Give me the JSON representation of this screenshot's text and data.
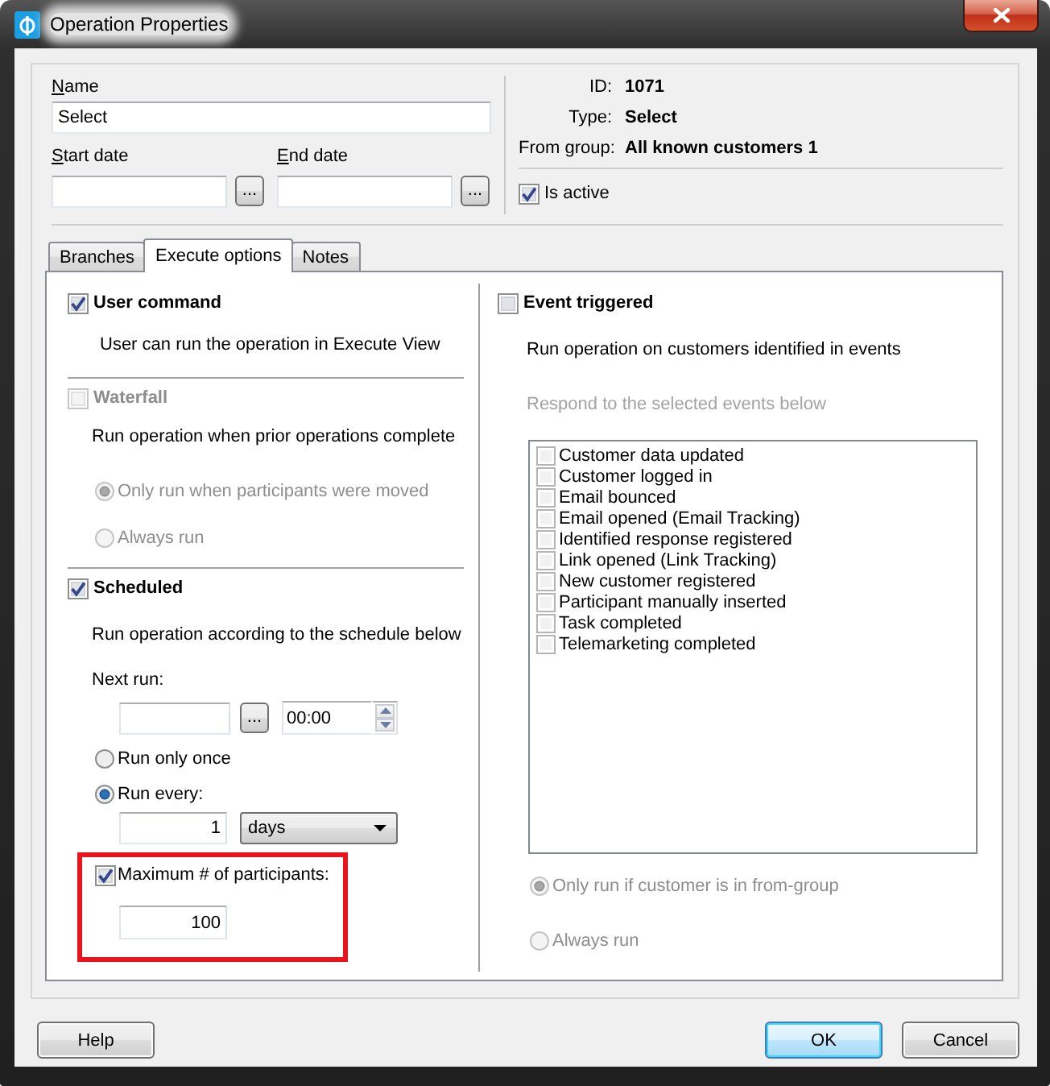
{
  "window": {
    "title": "Operation Properties"
  },
  "general": {
    "name": {
      "label": "Name",
      "value": "Select"
    },
    "start_date": {
      "label": "Start date",
      "button": "..."
    },
    "end_date": {
      "label": "End date",
      "button": "..."
    }
  },
  "info": [
    {
      "label": "ID:",
      "value": "1071"
    },
    {
      "label": "Type:",
      "value": "Select"
    },
    {
      "label": "From group:",
      "value": "All known customers 1"
    }
  ],
  "is_active": {
    "label": "Is active",
    "checked": true
  },
  "tabs": [
    {
      "label": "Branches",
      "selected": false
    },
    {
      "label": "Execute options",
      "selected": true
    },
    {
      "label": "Notes",
      "selected": false
    }
  ],
  "user_command": {
    "label": "User command",
    "checked": true,
    "disabled": false,
    "description": "User can run the operation in Execute View"
  },
  "waterfall": {
    "label": "Waterfall",
    "checked": false,
    "disabled": true,
    "description": "Run operation when prior operations complete",
    "options": [
      {
        "label": "Only run when participants were moved",
        "selected": true,
        "disabled": true
      },
      {
        "label": "Always run",
        "selected": false,
        "disabled": true
      }
    ]
  },
  "scheduled": {
    "label": "Scheduled",
    "checked": true,
    "disabled": false,
    "description": "Run operation according to the schedule below",
    "next_run": {
      "label": "Next run:",
      "button": "...",
      "time": "00:00"
    },
    "options": [
      {
        "label": "Run only once",
        "selected": false,
        "disabled": false
      },
      {
        "label": "Run every:",
        "selected": true,
        "disabled": false
      }
    ],
    "interval": {
      "value": "1",
      "unit": "days"
    },
    "max_participants": {
      "label": "Maximum # of participants:",
      "checked": true,
      "value": "100",
      "highlighted": true
    }
  },
  "event_triggered": {
    "label": "Event triggered",
    "checked": false,
    "disabled": false,
    "description": "Run operation on customers identified in events",
    "events_prompt": {
      "text": "Respond to the selected events below",
      "disabled": true
    },
    "events": [
      {
        "label": "Customer data updated",
        "checked": false
      },
      {
        "label": "Customer logged in",
        "checked": false
      },
      {
        "label": "Email bounced",
        "checked": false
      },
      {
        "label": "Email opened (Email Tracking)",
        "checked": false
      },
      {
        "label": "Identified response registered",
        "checked": false
      },
      {
        "label": "Link opened (Link Tracking)",
        "checked": false
      },
      {
        "label": "New customer registered",
        "checked": false
      },
      {
        "label": "Participant manually inserted",
        "checked": false
      },
      {
        "label": "Task completed",
        "checked": false
      },
      {
        "label": "Telemarketing completed",
        "checked": false
      }
    ],
    "options": [
      {
        "label": "Only run if customer is in from-group",
        "selected": true,
        "disabled": true
      },
      {
        "label": "Always run",
        "selected": false,
        "disabled": true
      }
    ]
  },
  "buttons": [
    {
      "label": "Help",
      "default": false
    },
    {
      "label": "OK",
      "default": true
    },
    {
      "label": "Cancel",
      "default": false
    }
  ]
}
